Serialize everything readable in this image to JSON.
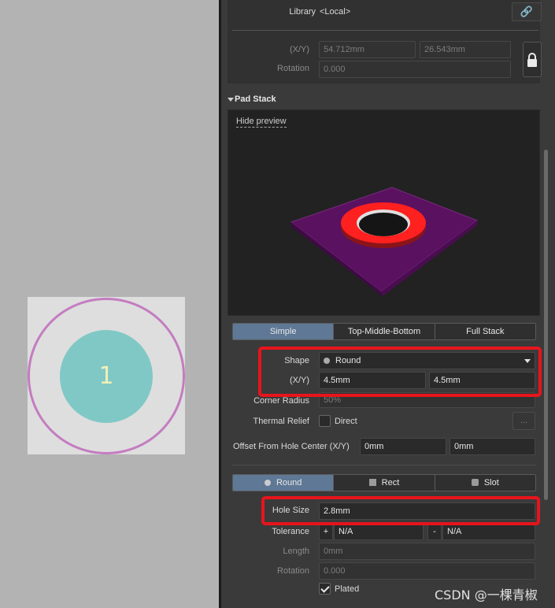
{
  "canvas": {
    "pad_number": "1"
  },
  "properties": {
    "library_label": "Library",
    "library_value": "<Local>",
    "link_icon": "link-icon",
    "xy_label": "(X/Y)",
    "x_value": "54.712mm",
    "y_value": "26.543mm",
    "rotation_label": "Rotation",
    "rotation_value": "0.000",
    "lock_icon": "lock-icon"
  },
  "pad_stack": {
    "title": "Pad Stack",
    "hide_preview": "Hide preview",
    "modes": [
      {
        "label": "Simple",
        "active": true
      },
      {
        "label": "Top-Middle-Bottom",
        "active": false
      },
      {
        "label": "Full Stack",
        "active": false
      }
    ],
    "shape_label": "Shape",
    "shape_value": "Round",
    "size_label": "(X/Y)",
    "size_x": "4.5mm",
    "size_y": "4.5mm",
    "corner_radius_label": "Corner Radius",
    "corner_radius_value": "50%",
    "thermal_relief_label": "Thermal Relief",
    "thermal_relief_value": "Direct",
    "thermal_btn": "...",
    "offset_label": "Offset From Hole Center (X/Y)",
    "offset_x": "0mm",
    "offset_y": "0mm",
    "hole_types": [
      {
        "label": "Round",
        "icon": "circle-icon",
        "active": true
      },
      {
        "label": "Rect",
        "icon": "square-icon",
        "active": false
      },
      {
        "label": "Slot",
        "icon": "rounded-square-icon",
        "active": false
      }
    ],
    "hole_size_label": "Hole Size",
    "hole_size_value": "2.8mm",
    "tolerance_label": "Tolerance",
    "tol_plus_sign": "+",
    "tol_plus_value": "N/A",
    "tol_minus_sign": "-",
    "tol_minus_value": "N/A",
    "length_label": "Length",
    "length_value": "0mm",
    "hole_rotation_label": "Rotation",
    "hole_rotation_value": "0.000",
    "plated_label": "Plated",
    "plated_checked": true
  },
  "colors": {
    "highlight": "#e8141c",
    "pad_copper": "#80c8c6",
    "pad_ring": "#c47cc0",
    "active_tab": "#5e7896",
    "board": "#5a1160",
    "ring_3d": "#ff2020"
  },
  "watermark": "CSDN @一棵青椒"
}
